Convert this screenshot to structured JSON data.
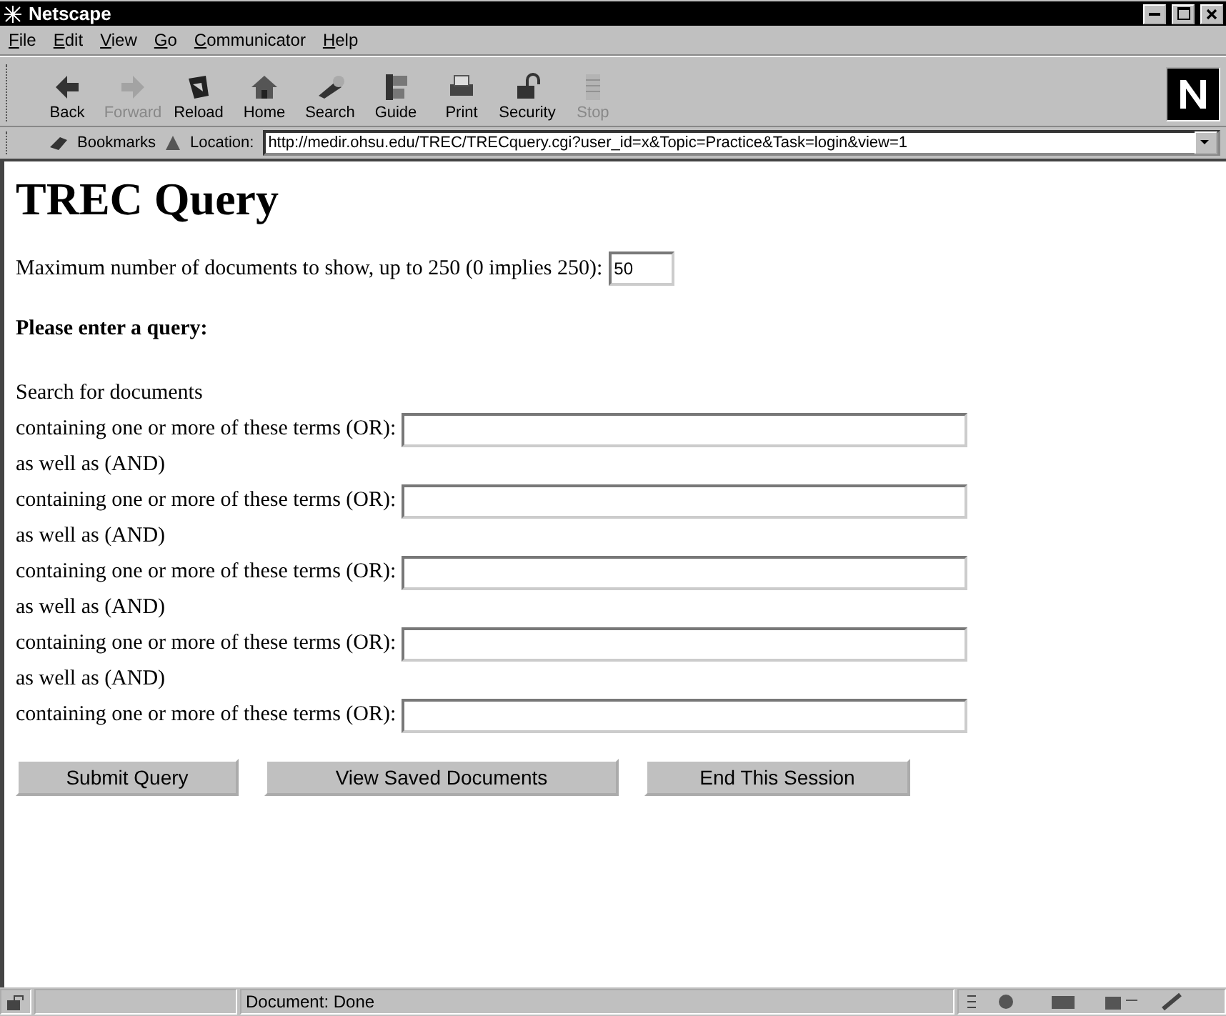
{
  "window": {
    "title": "Netscape"
  },
  "menu": [
    "File",
    "Edit",
    "View",
    "Go",
    "Communicator",
    "Help"
  ],
  "toolbar": [
    {
      "kind": "back",
      "label": "Back",
      "disabled": false
    },
    {
      "kind": "forward",
      "label": "Forward",
      "disabled": true
    },
    {
      "kind": "reload",
      "label": "Reload",
      "disabled": false
    },
    {
      "kind": "home",
      "label": "Home",
      "disabled": false
    },
    {
      "kind": "search",
      "label": "Search",
      "disabled": false
    },
    {
      "kind": "guide",
      "label": "Guide",
      "disabled": false
    },
    {
      "kind": "print",
      "label": "Print",
      "disabled": false
    },
    {
      "kind": "security",
      "label": "Security",
      "disabled": false
    },
    {
      "kind": "stop",
      "label": "Stop",
      "disabled": true
    }
  ],
  "location_bar": {
    "bookmarks": "Bookmarks",
    "label": "Location:",
    "url": "http://medir.ohsu.edu/TREC/TRECquery.cgi?user_id=x&Topic=Practice&Task=login&view=1"
  },
  "page": {
    "heading": "TREC Query",
    "max_docs": {
      "label": "Maximum number of documents to show, up to 250 (0 implies 250):",
      "value": "50"
    },
    "prompt": "Please enter a query:",
    "intro": "Search for documents",
    "term_rows": [
      {
        "label": "containing one or more of these terms (OR):",
        "connector": "as well as (AND)"
      },
      {
        "label": "containing one or more of these terms (OR):",
        "connector": "as well as (AND)"
      },
      {
        "label": "containing one or more of these terms (OR):",
        "connector": "as well as (AND)"
      },
      {
        "label": "containing one or more of these terms (OR):",
        "connector": "as well as (AND)"
      },
      {
        "label": "containing one or more of these terms (OR):"
      }
    ],
    "buttons": [
      "Submit Query",
      "View Saved Documents",
      "End This Session"
    ]
  },
  "status_bar": {
    "text": "Document: Done"
  }
}
